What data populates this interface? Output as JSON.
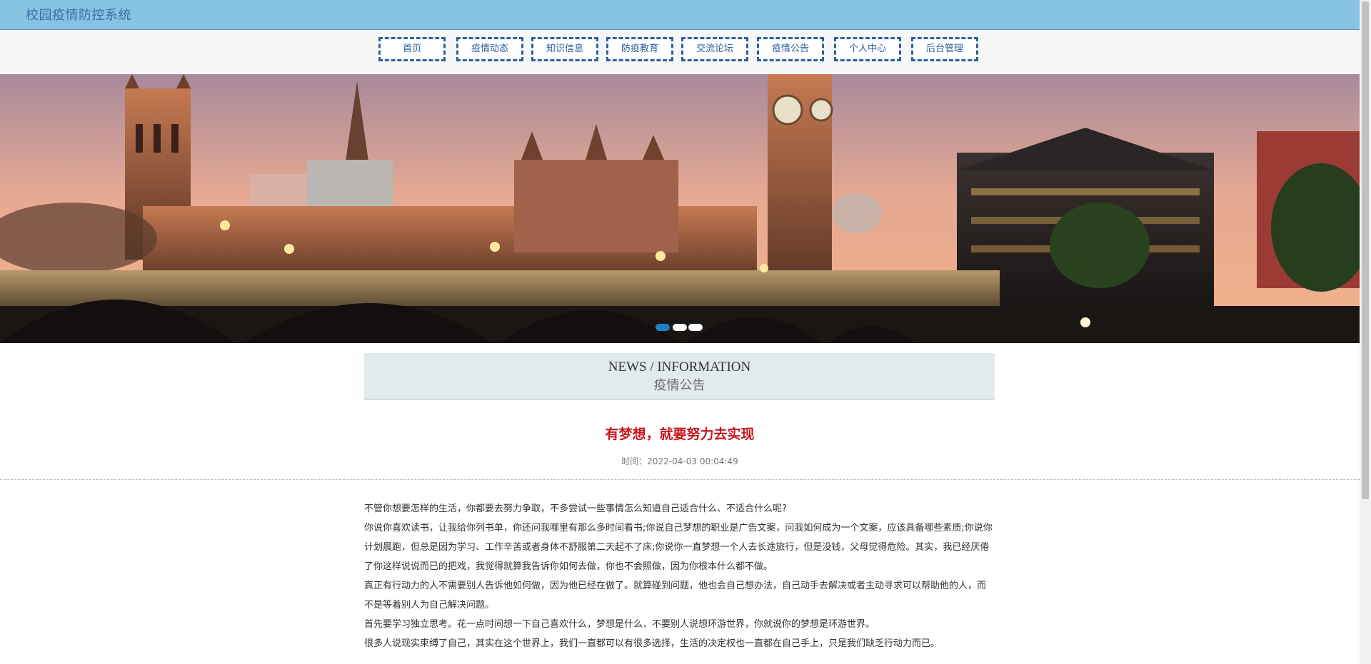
{
  "header": {
    "title": "校园疫情防控系统"
  },
  "nav": {
    "items": [
      {
        "label": "首页"
      },
      {
        "label": "疫情动态"
      },
      {
        "label": "知识信息"
      },
      {
        "label": "防疫教育"
      },
      {
        "label": "交流论坛"
      },
      {
        "label": "疫情公告"
      },
      {
        "label": "个人中心"
      },
      {
        "label": "后台管理"
      }
    ]
  },
  "banner": {
    "image": "london-westminster-skyline-photo",
    "slide_count": 3,
    "active_slide": 1
  },
  "section": {
    "heading_en": "NEWS / INFORMATION",
    "heading_cn": "疫情公告"
  },
  "article": {
    "title": "有梦想，就要努力去实现",
    "time": "时间：2022-04-03 00:04:49",
    "paragraphs": [
      "不管你想要怎样的生活，你都要去努力争取，不多尝试一些事情怎么知道自己适合什么、不适合什么呢?",
      "你说你喜欢读书，让我给你列书单，你还问我哪里有那么多时间看书;你说自己梦想的职业是广告文案，问我如何成为一个文案，应该具备哪些素质;你说你计划晨跑，但总是因为学习、工作辛苦或者身体不舒服第二天起不了床;你说你一直梦想一个人去长途旅行，但是没钱，父母觉得危险。其实，我已经厌倦了你这样说说而已的把戏，我觉得就算我告诉你如何去做，你也不会照做，因为你根本什么都不做。",
      "真正有行动力的人不需要别人告诉他如何做，因为他已经在做了。就算碰到问题，他也会自己想办法，自己动手去解决或者主动寻求可以帮助他的人，而不是等着别人为自己解决问题。",
      "首先要学习独立思考。花一点时间想一下自己喜欢什么，梦想是什么，不要别人说想环游世界，你就说你的梦想是环游世界。",
      "很多人说现实束缚了自己，其实在这个世界上，我们一直都可以有很多选择，生活的决定权也一直都在自己手上，只是我们缺乏行动力而已。"
    ]
  },
  "colors": {
    "header_bg": "#87c3e3",
    "nav_border": "#2f5f9b",
    "article_title": "#c8161d",
    "section_bg": "#e1eaed",
    "active_dot": "#1e7fc6"
  }
}
